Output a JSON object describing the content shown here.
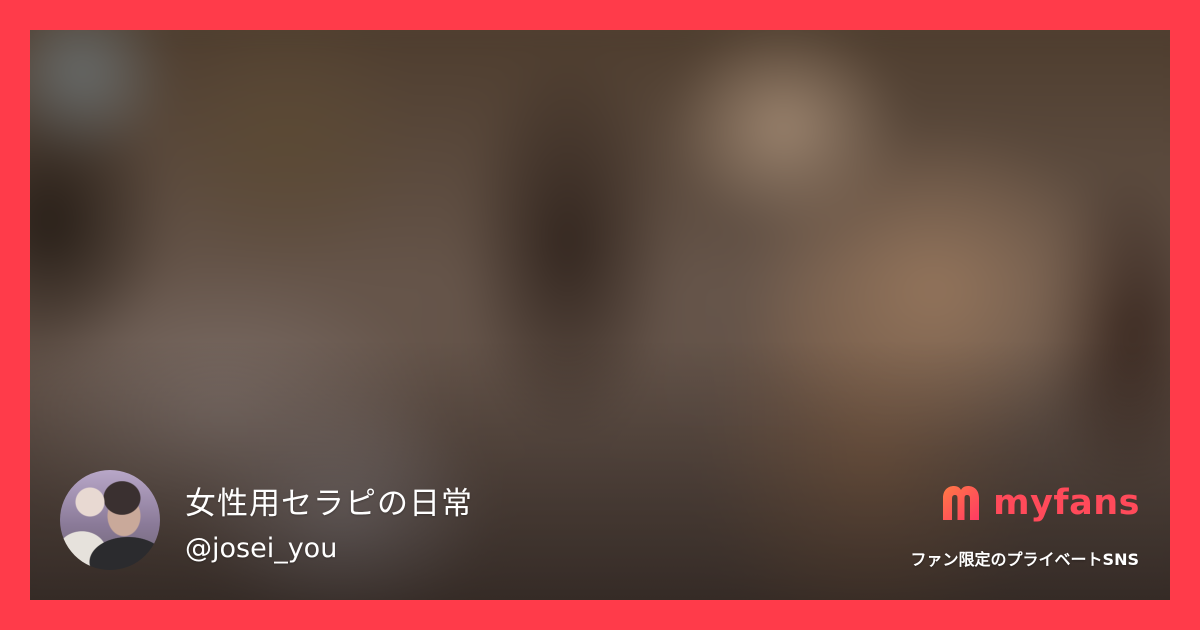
{
  "profile": {
    "display_name": "女性用セラピの日常",
    "handle": "@josei_you",
    "avatar_icon": "avatar-photo"
  },
  "brand": {
    "logo_icon": "myfans-logo-icon",
    "name": "myfans",
    "tagline": "ファン限定のプライベートSNS",
    "accent_color": "#ff4a5a"
  },
  "frame": {
    "border_color": "#ff3b4a"
  }
}
